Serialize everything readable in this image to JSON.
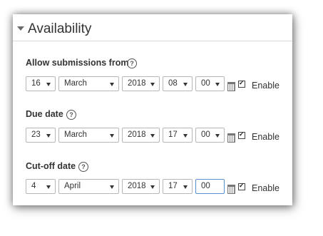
{
  "section": {
    "title": "Availability",
    "toggle_icon": "caret-down-icon"
  },
  "fields": [
    {
      "label": "Allow submissions from",
      "day": "16",
      "month": "March",
      "year": "2018",
      "hour": "08",
      "minute": "00",
      "enabled": true,
      "enable_label": "Enable"
    },
    {
      "label": "Due date",
      "day": "23",
      "month": "March",
      "year": "2018",
      "hour": "17",
      "minute": "00",
      "enabled": true,
      "enable_label": "Enable"
    },
    {
      "label": "Cut-off date",
      "day": "4",
      "month": "April",
      "year": "2018",
      "hour": "17",
      "minute": "00",
      "enabled": true,
      "enable_label": "Enable"
    }
  ],
  "icons": {
    "help": "question-circle-icon",
    "calendar": "calendar-icon"
  },
  "help_glyph": "?",
  "colors": {
    "focus_border": "#5a8fd6",
    "text": "#333333"
  }
}
